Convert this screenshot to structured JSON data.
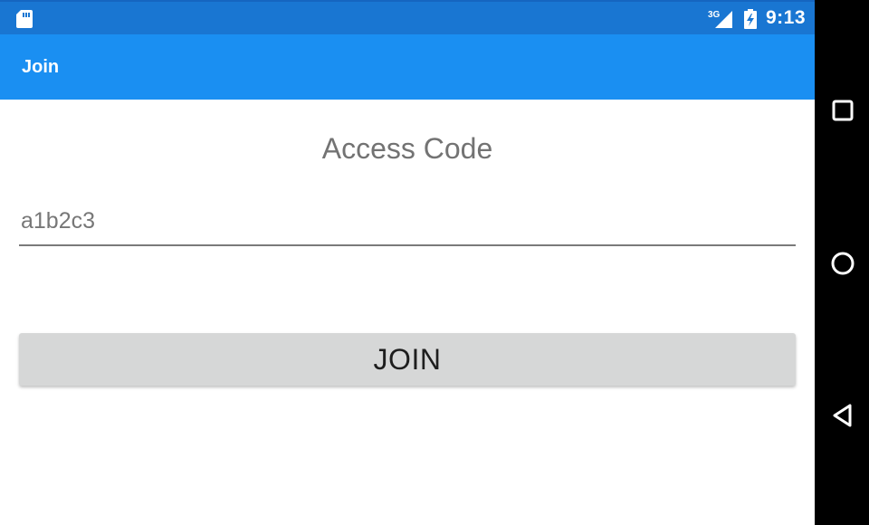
{
  "status_bar": {
    "time": "9:13",
    "network_label": "3G",
    "icons": [
      "sd-card-icon",
      "signal-3g-icon",
      "battery-charging-icon"
    ],
    "background": "#1976d2"
  },
  "app_bar": {
    "title": "Join",
    "background": "#1a8ff2"
  },
  "form": {
    "heading": "Access Code",
    "code_input": {
      "value": "a1b2c3",
      "placeholder": ""
    },
    "join_button_label": "JOIN"
  },
  "nav_bar": {
    "buttons": [
      "recents-square-icon",
      "home-circle-icon",
      "back-triangle-icon"
    ]
  }
}
